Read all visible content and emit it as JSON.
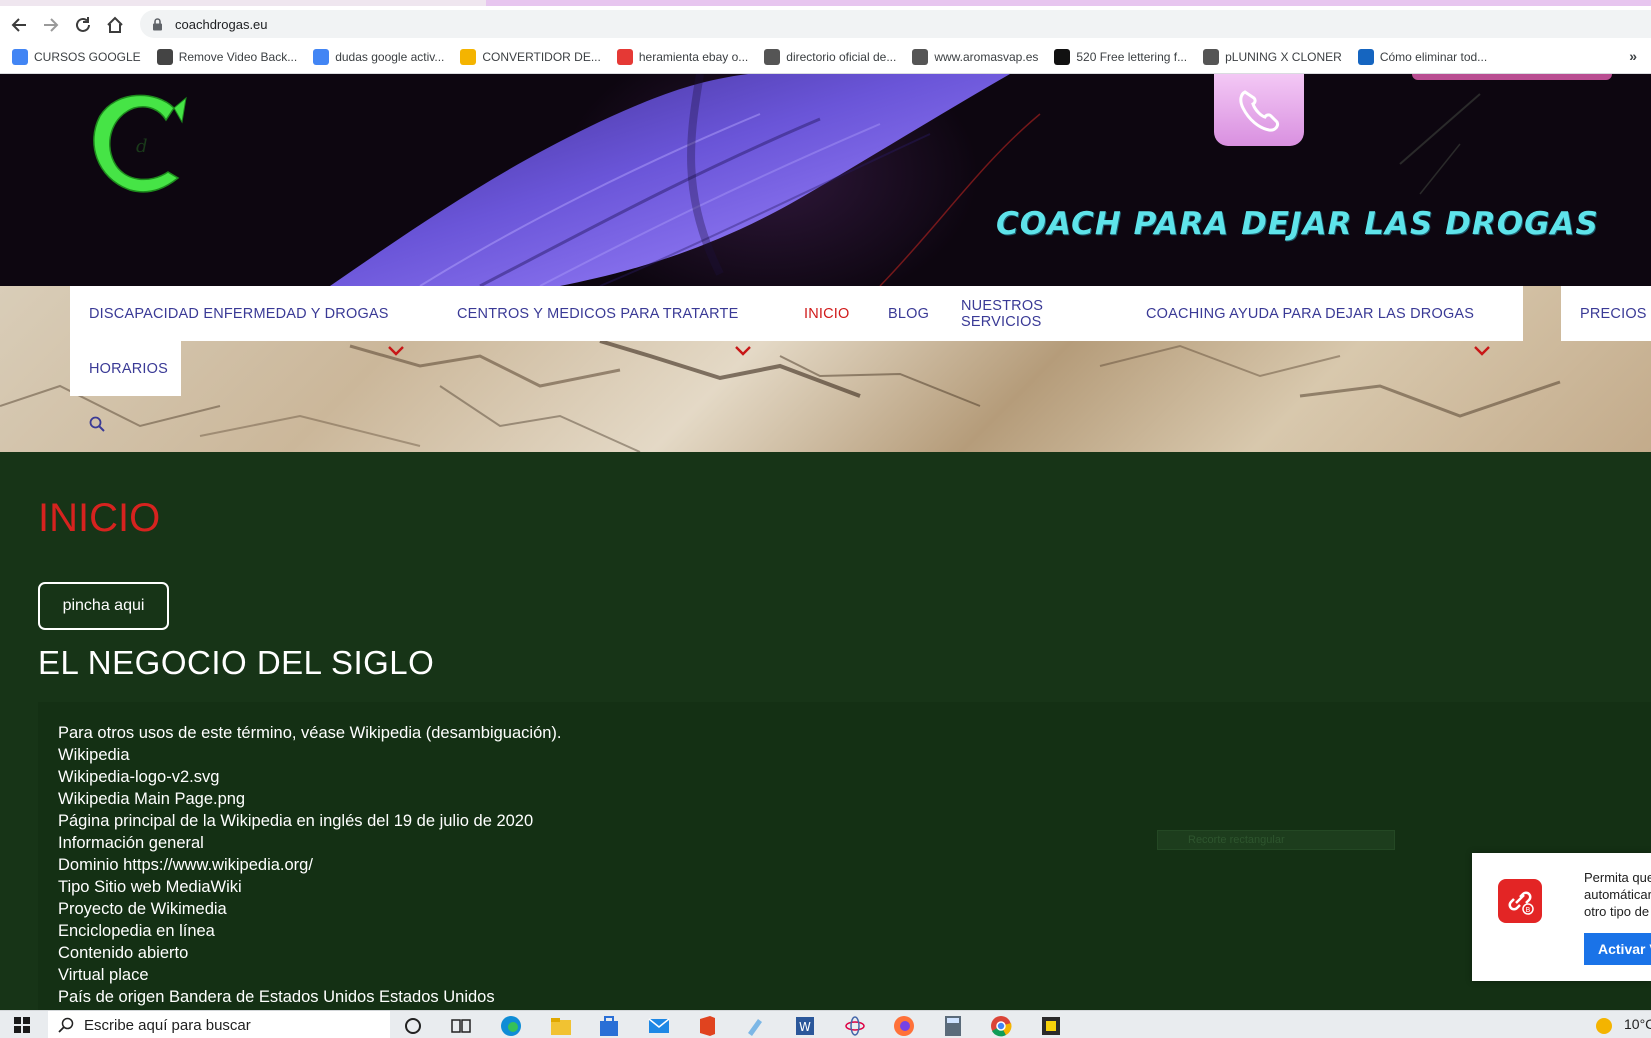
{
  "browser": {
    "url": "coachdrogas.eu",
    "bookmarks": [
      {
        "label": "CURSOS GOOGLE",
        "icon": "grid-icon",
        "color": "#4285f4"
      },
      {
        "label": "Remove Video Back...",
        "icon": "video-icon",
        "color": "#444444"
      },
      {
        "label": "dudas google activ...",
        "icon": "google-icon",
        "color": "#4285f4"
      },
      {
        "label": "CONVERTIDOR DE...",
        "icon": "folder-icon",
        "color": "#f4b400"
      },
      {
        "label": "heramienta ebay o...",
        "icon": "tag-icon",
        "color": "#e53935"
      },
      {
        "label": "directorio oficial de...",
        "icon": "wordpress-icon",
        "color": "#555555"
      },
      {
        "label": "www.aromasvap.es",
        "icon": "swirl-icon",
        "color": "#555555"
      },
      {
        "label": "520 Free lettering f...",
        "icon": "lettering-icon",
        "color": "#111111"
      },
      {
        "label": "pLUNING X CLONER",
        "icon": "wordpress-icon",
        "color": "#555555"
      },
      {
        "label": "Cómo eliminar tod...",
        "icon": "page-icon",
        "color": "#1565c0"
      }
    ],
    "more": "»"
  },
  "banner": {
    "title": "COACH  PARA DEJAR LAS DROGAS",
    "logo_letter": "C",
    "logo_sub": "d"
  },
  "menu": {
    "items": [
      {
        "label": "DISCAPACIDAD ENFERMEDAD Y DROGAS",
        "has_submenu": true
      },
      {
        "label": "CENTROS Y MEDICOS PARA TRATARTE",
        "has_submenu": true
      },
      {
        "label": "INICIO",
        "active": true
      },
      {
        "label": "BLOG"
      },
      {
        "label": "NUESTROS SERVICIOS"
      },
      {
        "label": "COACHING AYUDA PARA DEJAR LAS DROGAS",
        "has_submenu": true
      },
      {
        "label": "PRECIOS"
      },
      {
        "label": "HORARIOS"
      }
    ],
    "chevron": "⌄"
  },
  "main": {
    "page_title": "INICIO",
    "button_label": "pincha aqui",
    "section_title": "EL NEGOCIO DEL SIGLO",
    "lines": [
      "Para otros usos de este término, véase Wikipedia (desambiguación).",
      "Wikipedia",
      "Wikipedia-logo-v2.svg",
      "Wikipedia Main Page.png",
      "Página principal de la Wikipedia en inglés del 19 de julio de 2020",
      "Información general",
      "Dominio  https://www.wikipedia.org/",
      "Tipo Sitio web MediaWiki",
      "Proyecto de Wikimedia",
      "Enciclopedia en línea",
      "Contenido abierto",
      "Virtual place",
      "País de origen Bandera de Estados Unidos Estados Unidos"
    ],
    "ghost_tooltip": "Recorte rectangular"
  },
  "notification": {
    "text_lines": [
      "Permita que",
      "automáticar",
      "otro tipo de"
    ],
    "button": "Activar V"
  },
  "taskbar": {
    "search_placeholder": "Escribe aquí para buscar",
    "temperature": "10°C"
  },
  "colors": {
    "content_bg": "#173417",
    "title_red": "#d6231f",
    "menu_text": "#3a3a96",
    "banner_text": "#5ee3ea",
    "logo_green": "#46e446"
  }
}
